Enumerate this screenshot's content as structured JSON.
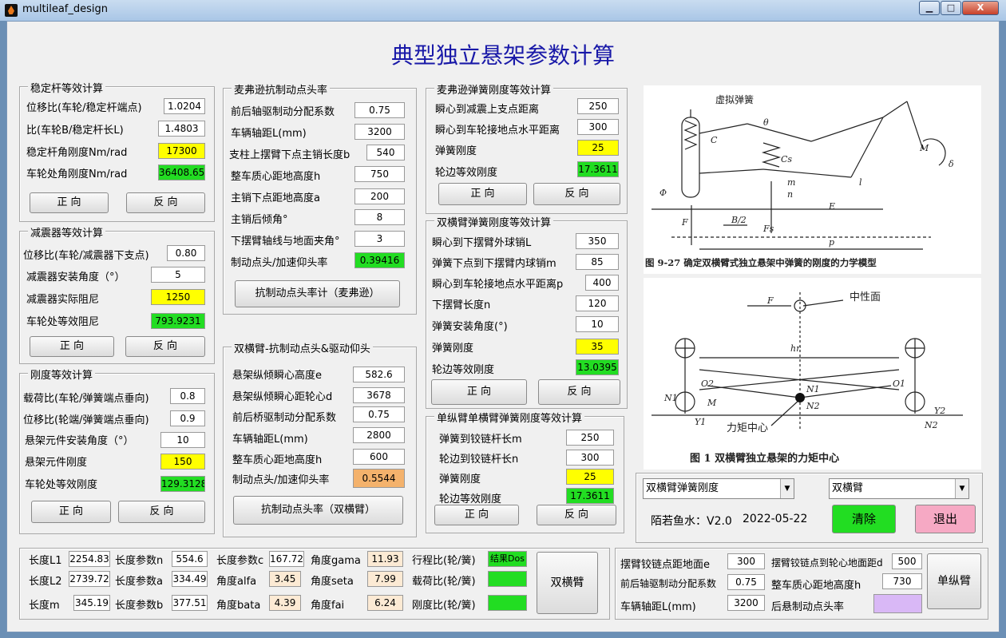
{
  "window": {
    "title": "multileaf_design",
    "min": "▁",
    "max": "□",
    "close": "X"
  },
  "main_title": "典型独立悬架参数计算",
  "stab": {
    "title": "稳定杆等效计算",
    "rows": [
      {
        "label": "位移比(车轮/稳定杆端点)",
        "value": "1.0204"
      },
      {
        "label": "比(车轮B/稳定杆长L)",
        "value": "1.4803"
      },
      {
        "label": "稳定杆角刚度Nm/rad",
        "value": "17300"
      },
      {
        "label": "车轮处角刚度Nm/rad",
        "value": "36408.65"
      }
    ],
    "fwd": "正 向",
    "rev": "反 向"
  },
  "damper": {
    "title": "减震器等效计算",
    "rows": [
      {
        "label": "位移比(车轮/减震器下支点)",
        "value": "0.80"
      },
      {
        "label": "减震器安装角度（°）",
        "value": "5"
      },
      {
        "label": "减震器实际阻尼",
        "value": "1250"
      },
      {
        "label": "车轮处等效阻尼",
        "value": "793.9231"
      }
    ],
    "fwd": "正 向",
    "rev": "反 向"
  },
  "stiff": {
    "title": "刚度等效计算",
    "rows": [
      {
        "label": "载荷比(车轮/弹簧端点垂向)",
        "value": "0.8"
      },
      {
        "label": "位移比(轮端/弹簧端点垂向)",
        "value": "0.9"
      },
      {
        "label": "悬架元件安装角度（°）",
        "value": "10"
      },
      {
        "label": "悬架元件刚度",
        "value": "150"
      },
      {
        "label": "车轮处等效刚度",
        "value": "129.3128"
      }
    ],
    "fwd": "正 向",
    "rev": "反 向"
  },
  "mcp_anti": {
    "title": "麦弗逊抗制动点头率",
    "rows": [
      {
        "label": "前后轴驱制动分配系数",
        "value": "0.75"
      },
      {
        "label": "车辆轴距L(mm)",
        "value": "3200"
      },
      {
        "label": "支柱上摆臂下点主销长度b",
        "value": "540"
      },
      {
        "label": "整车质心距地高度h",
        "value": "750"
      },
      {
        "label": "主销下点距地高度a",
        "value": "200"
      },
      {
        "label": "主销后倾角°",
        "value": "8"
      },
      {
        "label": "下摆臂轴线与地面夹角°",
        "value": "3"
      },
      {
        "label": "制动点头/加速仰头率",
        "value": "0.39416"
      }
    ],
    "button": "抗制动点头率计（麦弗逊）"
  },
  "dw_anti": {
    "title": "双横臂-抗制动点头&驱动仰头",
    "rows": [
      {
        "label": "悬架纵倾瞬心高度e",
        "value": "582.6"
      },
      {
        "label": "悬架纵倾瞬心距轮心d",
        "value": "3678"
      },
      {
        "label": "前后桥驱制动分配系数",
        "value": "0.75"
      },
      {
        "label": "车辆轴距L(mm)",
        "value": "2800"
      },
      {
        "label": "整车质心距地高度h",
        "value": "600"
      },
      {
        "label": "制动点头/加速仰头率",
        "value": "0.5544"
      }
    ],
    "button": "抗制动点头率（双横臂）"
  },
  "mcp_spring": {
    "title": "麦弗逊弹簧刚度等效计算",
    "rows": [
      {
        "label": "瞬心到减震上支点距离",
        "value": "250"
      },
      {
        "label": "瞬心到车轮接地点水平距离",
        "value": "300"
      },
      {
        "label": "弹簧刚度",
        "value": "25"
      },
      {
        "label": "轮边等效刚度",
        "value": "17.3611"
      }
    ],
    "fwd": "正 向",
    "rev": "反 向"
  },
  "dw_spring": {
    "title": "双横臂弹簧刚度等效计算",
    "rows": [
      {
        "label": "瞬心到下摆臂外球销L",
        "value": "350"
      },
      {
        "label": "弹簧下点到下摆臂内球销m",
        "value": "85"
      },
      {
        "label": "瞬心到车轮接地点水平距离p",
        "value": "400"
      },
      {
        "label": "下摆臂长度n",
        "value": "120"
      },
      {
        "label": "弹簧安装角度(°)",
        "value": "10"
      },
      {
        "label": "弹簧刚度",
        "value": "35"
      },
      {
        "label": "轮边等效刚度",
        "value": "13.0395"
      }
    ],
    "fwd": "正 向",
    "rev": "反 向"
  },
  "sl_spring": {
    "title": "单纵臂单横臂弹簧刚度等效计算",
    "rows": [
      {
        "label": "弹簧到铰链杆长m",
        "value": "250"
      },
      {
        "label": "轮边到铰链杆长n",
        "value": "300"
      },
      {
        "label": "弹簧刚度",
        "value": "25"
      },
      {
        "label": "轮边等效刚度",
        "value": "17.3611"
      }
    ],
    "fwd": "正 向",
    "rev": "反 向"
  },
  "fig1": {
    "spring_label": "虚拟弹簧",
    "caption": "图 9-27  确定双横臂式独立悬架中弹簧的刚度的力学模型",
    "letters": [
      "C",
      "θ",
      "M",
      "δ",
      "Cs",
      "m",
      "n",
      "l",
      "Φ",
      "F",
      "B/2",
      "E",
      "Fs",
      "p"
    ]
  },
  "fig2": {
    "neutral": "中性面",
    "moment": "力矩中心",
    "caption": "图 1  双横臂独立悬架的力矩中心",
    "letters": [
      "F",
      "hr",
      "O2",
      "O1",
      "N1",
      "N2",
      "M",
      "Y1",
      "Y2",
      "N2",
      "N1"
    ]
  },
  "selectors": {
    "left": "双横臂弹簧刚度",
    "right": "双横臂"
  },
  "author": "陌若鱼水：V2.0",
  "date": "2022-05-22",
  "clear": "清除",
  "exit": "退出",
  "geo": {
    "row1": [
      {
        "label": "长度L1",
        "value": "2254.83"
      },
      {
        "label": "长度参数n",
        "value": "554.6"
      },
      {
        "label": "长度参数c",
        "value": "167.72"
      },
      {
        "label": "角度gama",
        "value": "11.93"
      },
      {
        "label": "行程比(轮/簧)",
        "value": "结果Dos"
      }
    ],
    "row2": [
      {
        "label": "长度L2",
        "value": "2739.72"
      },
      {
        "label": "长度参数a",
        "value": "334.49"
      },
      {
        "label": "角度alfa",
        "value": "3.45"
      },
      {
        "label": "角度seta",
        "value": "7.99"
      },
      {
        "label": "载荷比(轮/簧)",
        "value": ""
      }
    ],
    "row3": [
      {
        "label": "长度m",
        "value": "345.19"
      },
      {
        "label": "长度参数b",
        "value": "377.51"
      },
      {
        "label": "角度bata",
        "value": "4.39"
      },
      {
        "label": "角度fai",
        "value": "6.24"
      },
      {
        "label": "刚度比(轮/簧)",
        "value": ""
      }
    ],
    "button": "双横臂"
  },
  "trail": {
    "rows": [
      [
        {
          "label": "摆臂铰链点距地面e",
          "value": "300"
        },
        {
          "label": "摆臂铰链点到轮心地面距d",
          "value": "500"
        }
      ],
      [
        {
          "label": "前后轴驱制动分配系数",
          "value": "0.75"
        },
        {
          "label": "整车质心距地高度h",
          "value": "730"
        }
      ],
      [
        {
          "label": "车辆轴距L(mm)",
          "value": "3200"
        },
        {
          "label": "后悬制动点头率",
          "value": ""
        }
      ]
    ],
    "button": "单纵臂"
  }
}
